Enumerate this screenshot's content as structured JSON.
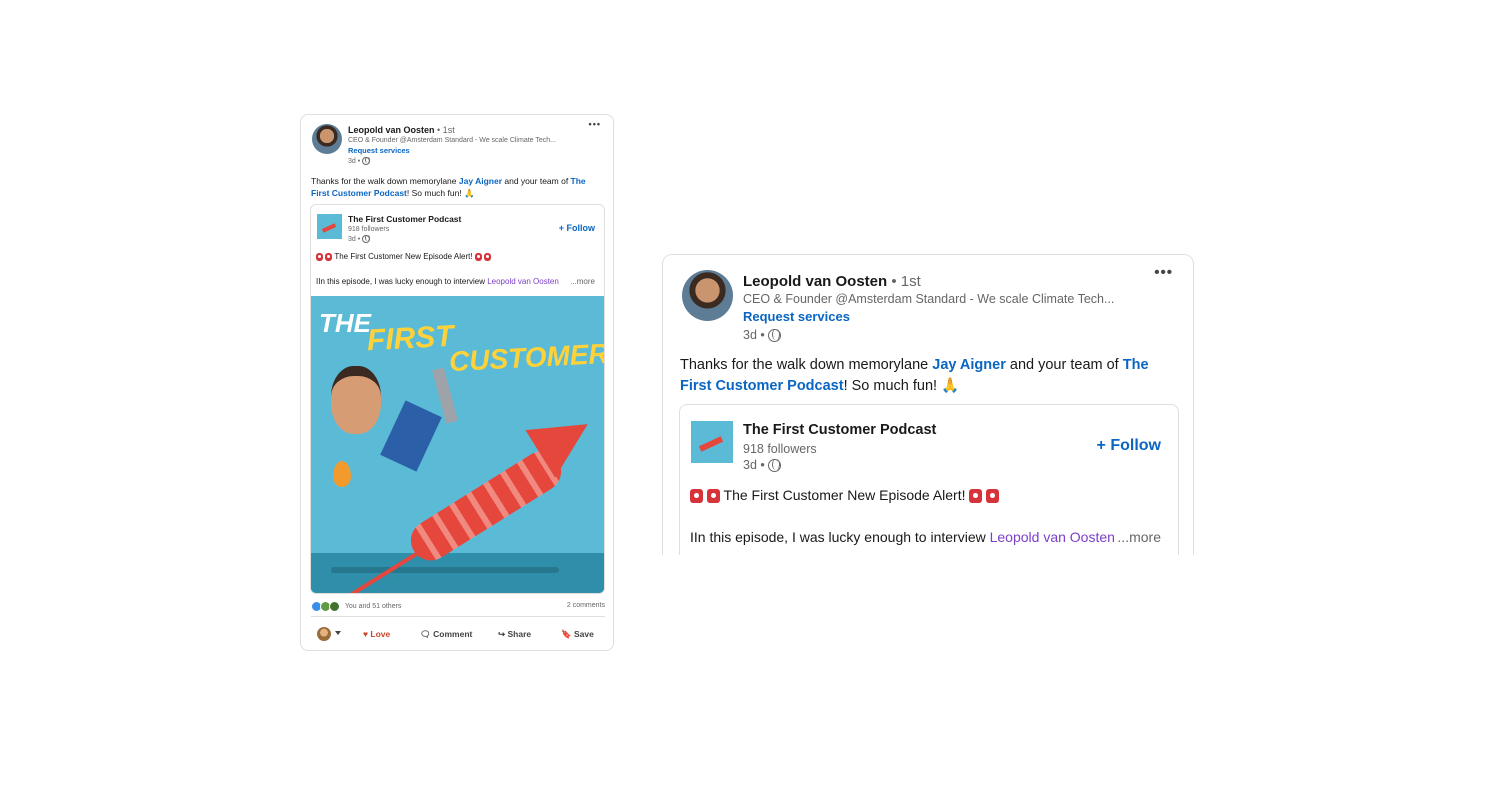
{
  "post": {
    "author": "Leopold van Oosten",
    "degree": "• 1st",
    "headline": "CEO & Founder @Amsterdam Standard - We scale Climate Tech...",
    "request_services": "Request services",
    "time": "3d •",
    "text_before_mention1": "Thanks for the walk down memorylane ",
    "mention1": "Jay Aigner",
    "text_between": " and your team of ",
    "mention2": "The First Customer Podcast",
    "text_after": "! So much fun! 🙏"
  },
  "shared": {
    "name": "The First Customer Podcast",
    "followers": "918 followers",
    "time": "3d •",
    "follow": "+ Follow",
    "alert_text": "The First Customer New Episode Alert!",
    "interview_text": "IIn this episode, I was lucky enough to interview ",
    "interview_mention": "Leopold van Oosten",
    "more": "...more"
  },
  "cover": {
    "line1": "THE",
    "line2": "FIRST",
    "line3": "CUSTOMER"
  },
  "social": {
    "reactions": "You and 51 others",
    "comments": "2 comments"
  },
  "actions": {
    "love": "Love",
    "comment": "Comment",
    "share": "Share",
    "save": "Save"
  },
  "colors": {
    "link_blue": "#0a66c2",
    "mention_purple": "#7b3fc9",
    "love_red": "#c6462b",
    "cover_blue": "#5bbbd6",
    "rocket_red": "#e5473d"
  },
  "icons": [
    "more-icon",
    "globe-icon",
    "siren-icon",
    "heart-icon",
    "comment-icon",
    "share-icon",
    "bookmark-icon",
    "caret-down-icon"
  ]
}
